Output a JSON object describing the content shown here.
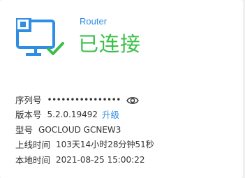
{
  "device": {
    "type_label": "Router",
    "status": "已连接",
    "status_color": "#3bbf4a",
    "accent_color": "#2f8de4",
    "icon": "router-connected-icon"
  },
  "info": {
    "serial": {
      "label": "序列号",
      "value_masked": "••••••••••••••••",
      "toggle_icon": "eye-icon"
    },
    "version": {
      "label": "版本号",
      "value": "5.2.0.19492",
      "upgrade_label": "升级"
    },
    "model": {
      "label": "型号",
      "value": "GOCLOUD GCNEW3"
    },
    "uptime": {
      "label": "上线时间",
      "value": "103天14小时28分钟51秒"
    },
    "local_time": {
      "label": "本地时间",
      "value": "2021-08-25 15:00:22"
    }
  }
}
